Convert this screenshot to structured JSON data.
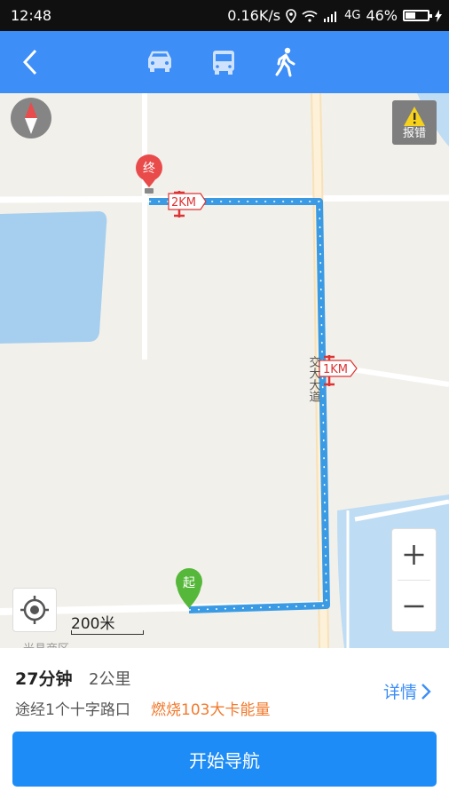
{
  "status_bar": {
    "time": "12:48",
    "network_speed": "0.16K/s",
    "network_type": "4G",
    "battery": "46%",
    "battery_level": 0.46
  },
  "top_bar": {
    "modes": [
      "car-icon",
      "bus-icon",
      "walk-icon"
    ],
    "selected_mode": "walk"
  },
  "map": {
    "end_marker": "终",
    "start_marker": "起",
    "km_markers": [
      "2KM",
      "1KM"
    ],
    "road_label": "交大大道",
    "report_label": "报错",
    "scale_label": "200米",
    "area_label": "光县商区"
  },
  "summary": {
    "duration": "27分钟",
    "distance": "2公里",
    "via": "途经1个十字路口",
    "calories": "燃烧103大卡能量",
    "details_label": "详情"
  },
  "start_button": "开始导航",
  "colors": {
    "accent": "#3d8ef7",
    "route": "#43a5e8",
    "end_marker": "#e94b4b",
    "start_marker": "#56b83a",
    "calories": "#f2792c"
  }
}
